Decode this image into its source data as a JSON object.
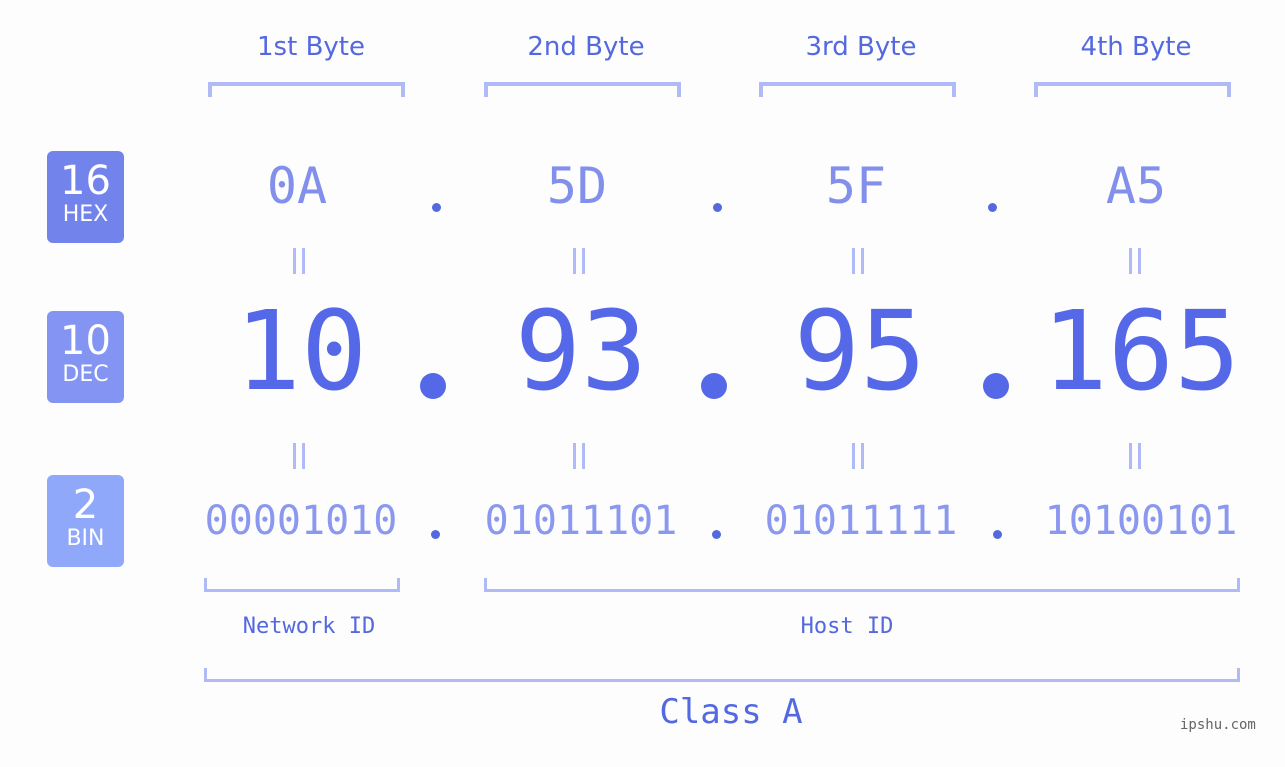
{
  "byte_headers": [
    "1st Byte",
    "2nd Byte",
    "3rd Byte",
    "4th Byte"
  ],
  "badges": {
    "hex": {
      "base": "16",
      "label": "HEX",
      "color": "#7383ec"
    },
    "dec": {
      "base": "10",
      "label": "DEC",
      "color": "#8494f2"
    },
    "bin": {
      "base": "2",
      "label": "BIN",
      "color": "#8fa8fa"
    }
  },
  "hex_octets": [
    "0A",
    "5D",
    "5F",
    "A5"
  ],
  "dec_octets": [
    "10",
    "93",
    "95",
    "165"
  ],
  "bin_octets": [
    "00001010",
    "01011101",
    "01011111",
    "10100101"
  ],
  "segments": {
    "network_id": "Network ID",
    "host_id": "Host ID"
  },
  "ip_class": "Class A",
  "watermark": "ipshu.com",
  "colors": {
    "accent": "#5468e0",
    "bracket": "#b0baf7",
    "hex_text": "#8290ec",
    "bin_text": "#8b98f0"
  }
}
